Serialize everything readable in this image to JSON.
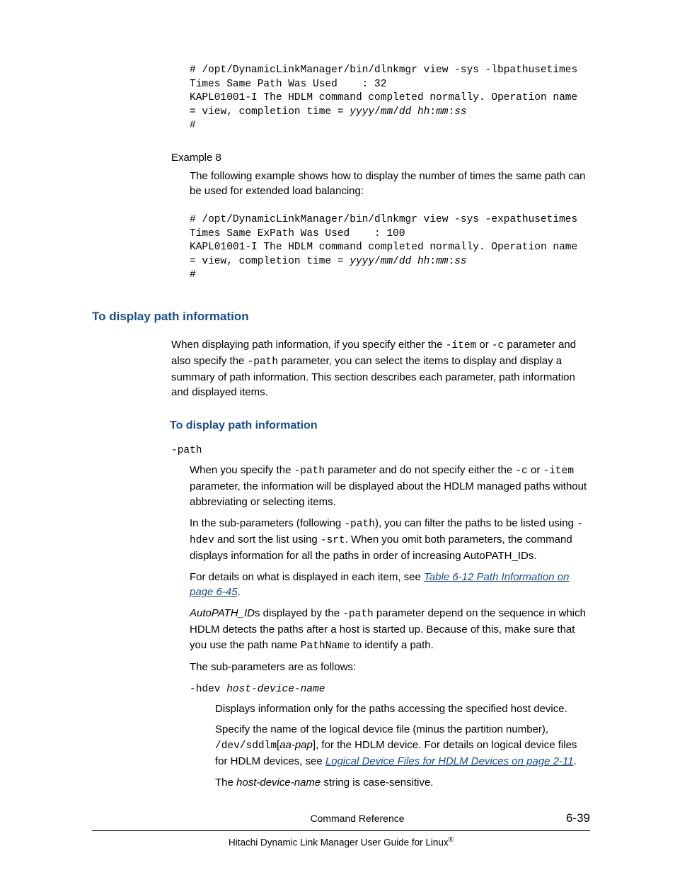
{
  "codeblock1_l1": "# /opt/DynamicLinkManager/bin/dlnkmgr view -sys -lbpathusetimes",
  "codeblock1_l2": "Times Same Path Was Used    : 32",
  "codeblock1_l3": "KAPL01001-I The HDLM command completed normally. Operation name ",
  "codeblock1_l4a": "= view, completion time = ",
  "codeblock1_l4b": "yyyy",
  "codeblock1_l4c": "/",
  "codeblock1_l4d": "mm",
  "codeblock1_l4e": "/",
  "codeblock1_l4f": "dd hh",
  "codeblock1_l4g": ":",
  "codeblock1_l4h": "mm",
  "codeblock1_l4i": ":",
  "codeblock1_l4j": "ss",
  "codeblock1_l5": "#",
  "example_label": "Example 8",
  "example_text": "The following example shows how to display the number of times the same path can be used for extended load balancing:",
  "codeblock2_l1": "# /opt/DynamicLinkManager/bin/dlnkmgr view -sys -expathusetimes",
  "codeblock2_l2": "Times Same ExPath Was Used    : 100",
  "codeblock2_l3": "KAPL01001-I The HDLM command completed normally. Operation name ",
  "codeblock2_l4a": "= view, completion time = ",
  "codeblock2_l5": "#",
  "h1": "To display path information",
  "intro_a": "When displaying path information, if you specify either the ",
  "intro_b": "-item",
  "intro_c": " or ",
  "intro_d": "-c",
  "intro_e": " parameter and also specify the ",
  "intro_f": "-path",
  "intro_g": " parameter, you can select the items to display and display a summary of path information. This section describes each parameter, path information and displayed items.",
  "h2": "To display path information",
  "param1": "-path",
  "p1_a": "When you specify the ",
  "p1_b": "-path",
  "p1_c": " parameter and do not specify either the ",
  "p1_d": "-c",
  "p1_e": " or ",
  "p1_f": "-item",
  "p1_g": " parameter, the information will be displayed about the HDLM managed paths without abbreviating or selecting items.",
  "p2_a": "In the sub-parameters (following ",
  "p2_b": "-path",
  "p2_c": "), you can filter the paths to be listed using ",
  "p2_d": "-hdev",
  "p2_e": " and sort the list using ",
  "p2_f": "-srt",
  "p2_g": ". When you omit both parameters, the command displays information for all the paths in order of increasing AutoPATH_IDs.",
  "p3_a": "For details on what is displayed in each item, see ",
  "p3_link": "Table 6-12 Path Information on page 6-45",
  "p3_c": ".",
  "p4_a": "AutoPATH_ID",
  "p4_b": "s displayed by the ",
  "p4_c": "-path",
  "p4_d": " parameter depend on the sequence in which HDLM detects the paths after a host is started up. Because of this, make sure that you use the path name ",
  "p4_e": "PathName",
  "p4_f": " to identify a path.",
  "p5": "The sub-parameters are as follows:",
  "sub1_a": "-hdev ",
  "sub1_b": "host-device-name",
  "sp1": "Displays information only for the paths accessing the specified host device.",
  "sp2_a": "Specify the name of the logical device file (minus the partition number), ",
  "sp2_b": "/dev/sddlm",
  "sp2_c": "[",
  "sp2_d": "aa-pap",
  "sp2_e": "]",
  "sp2_f": ", for the HDLM device. For details on logical device files for HDLM devices, see ",
  "sp2_link": "Logical Device Files for HDLM Devices on page 2-11",
  "sp2_h": ".",
  "sp3_a": "The ",
  "sp3_b": "host-device-name",
  "sp3_c": " string is case-sensitive.",
  "footer_center": "Command Reference",
  "footer_page": "6-39",
  "footer_guide_a": "Hitachi Dynamic Link Manager User Guide for Linux",
  "footer_guide_b": "®"
}
